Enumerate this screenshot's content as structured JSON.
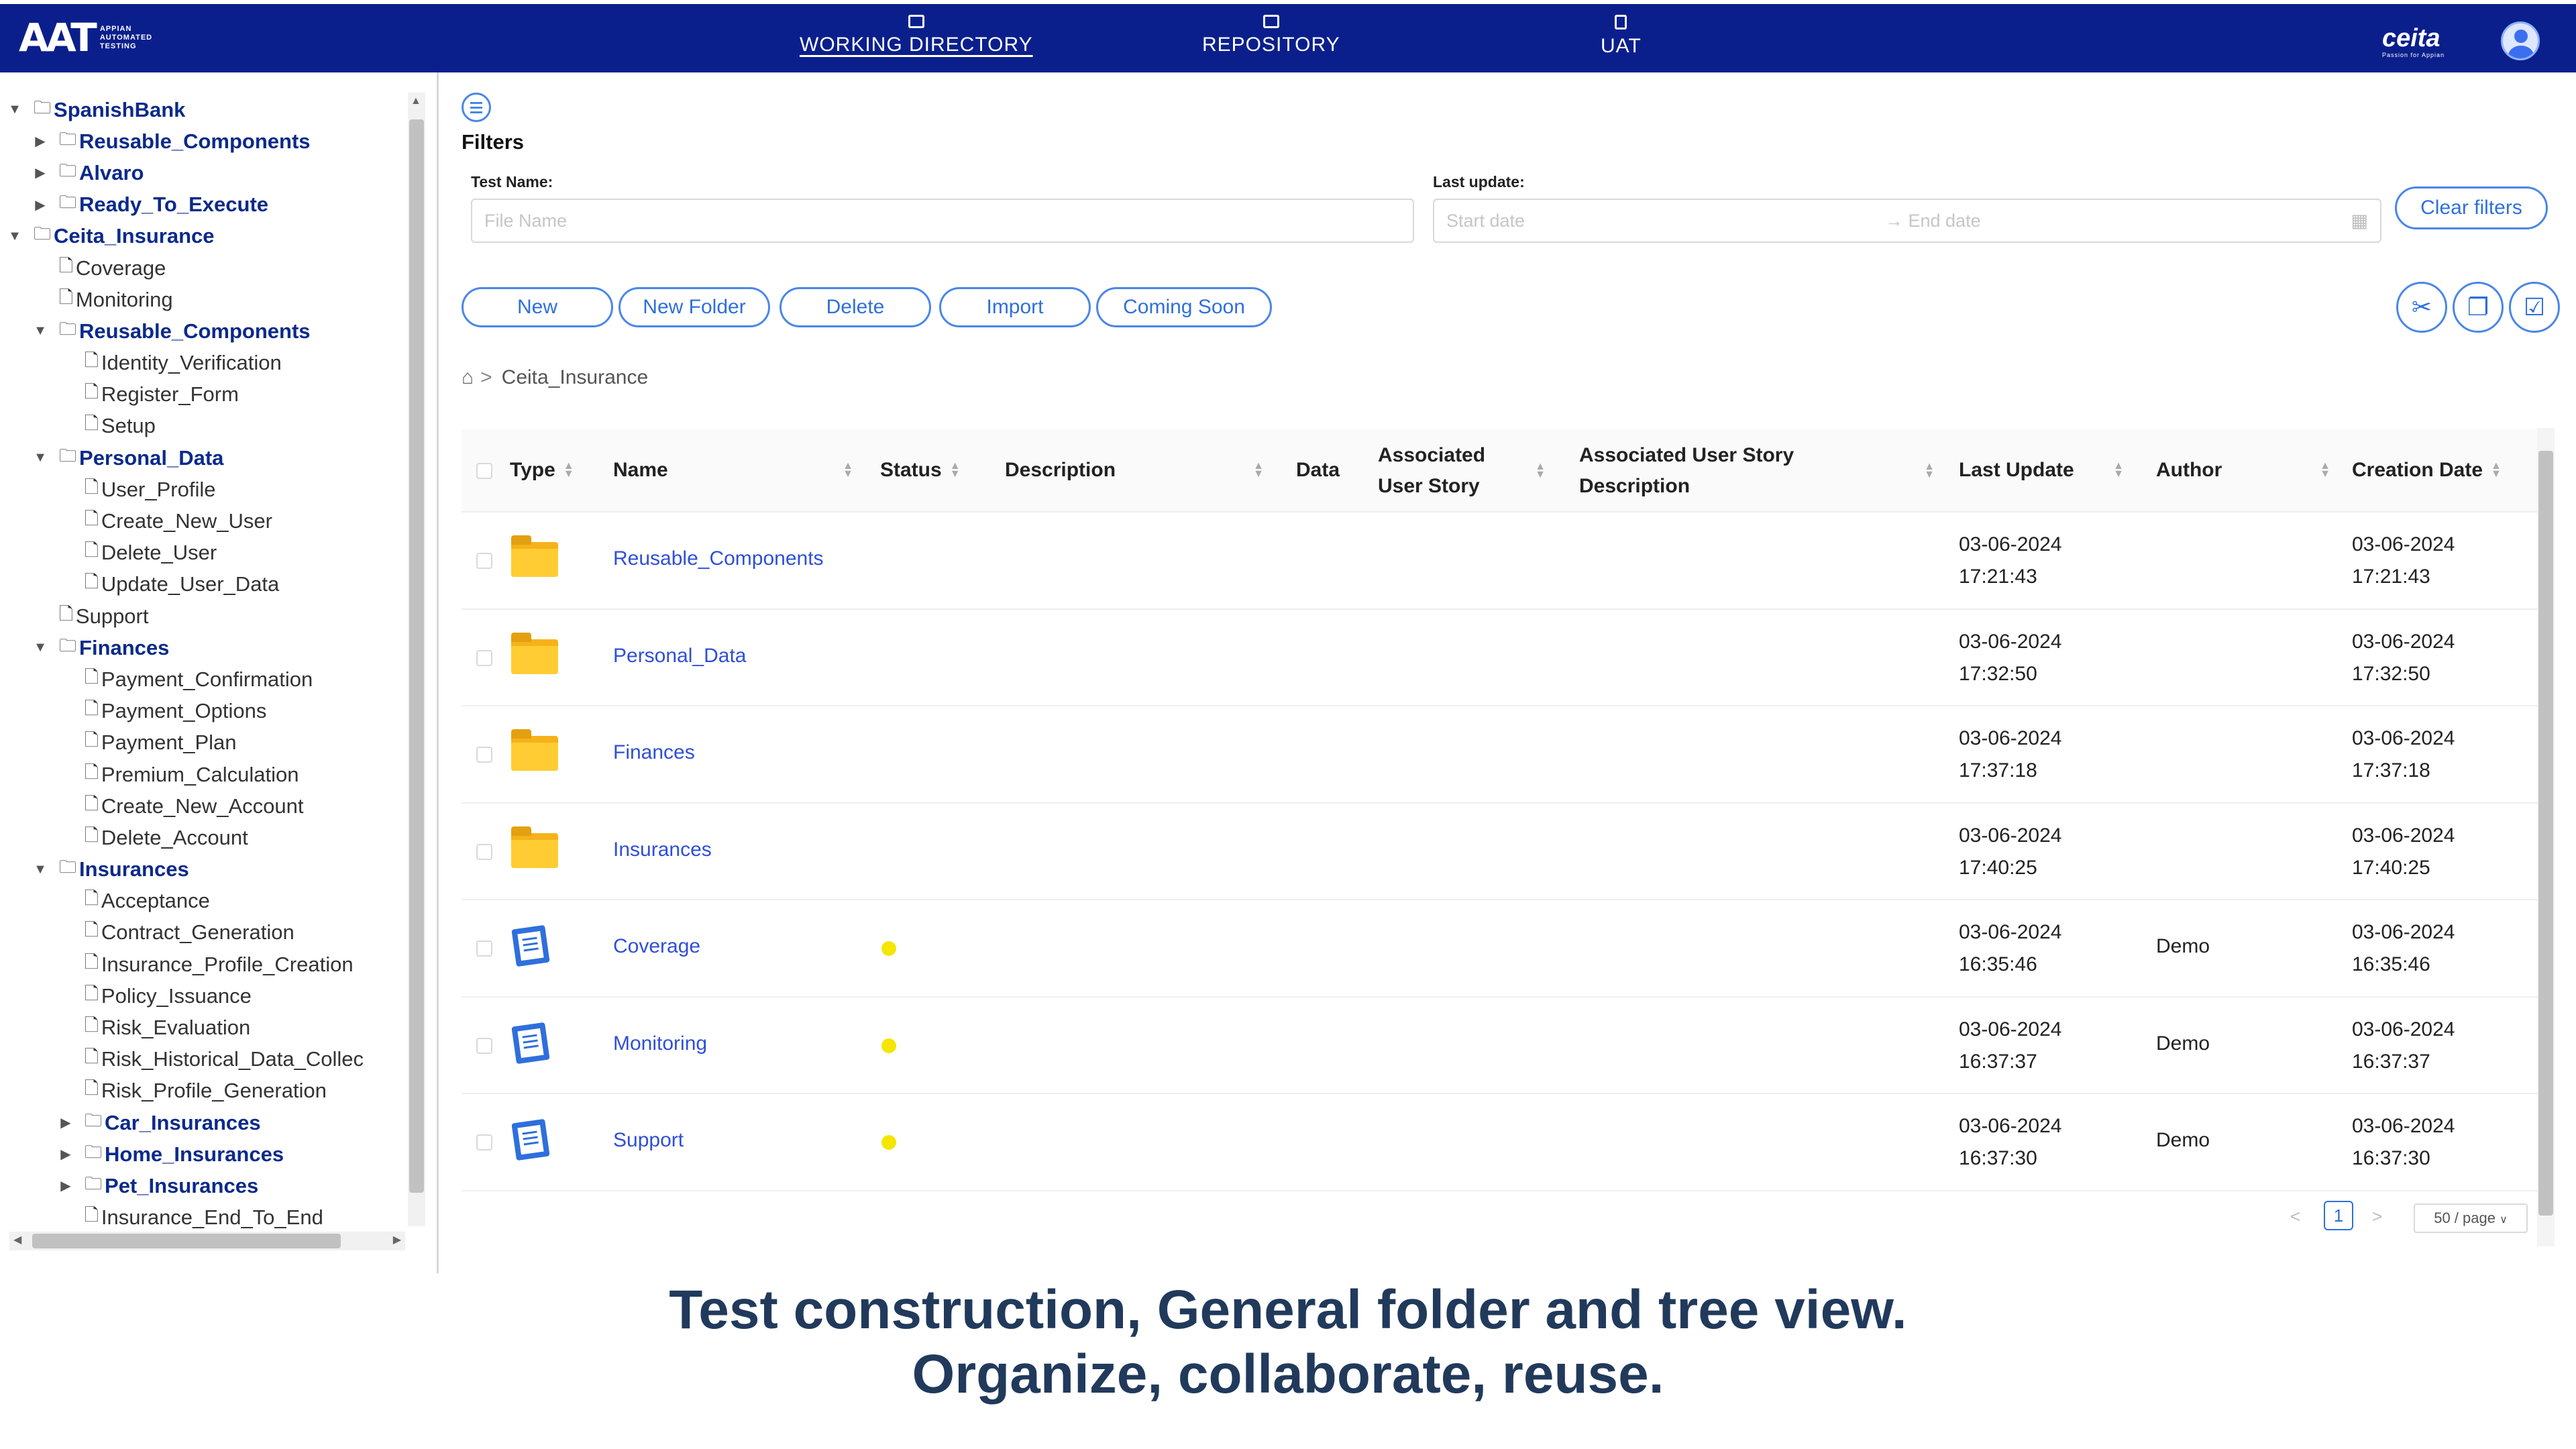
{
  "nav": {
    "logo": "AAT",
    "logo_sub": "APPIAN AUTOMATED TESTING",
    "items": [
      {
        "label": "WORKING DIRECTORY",
        "icon": "folder-grid-icon"
      },
      {
        "label": "REPOSITORY",
        "icon": "folder-icon"
      },
      {
        "label": "UAT",
        "icon": "clipboard-icon"
      }
    ],
    "brand": "ceita",
    "brand_sub": "Passion for Appian"
  },
  "tree": [
    {
      "label": "SpanishBank",
      "type": "folder",
      "toggle": "▼"
    },
    {
      "label": "Reusable_Components",
      "type": "folder",
      "toggle": "▶"
    },
    {
      "label": "Alvaro",
      "type": "folder",
      "toggle": "▶"
    },
    {
      "label": "Ready_To_Execute",
      "type": "folder",
      "toggle": "▶"
    },
    {
      "label": "Ceita_Insurance",
      "type": "folder",
      "toggle": "▼"
    },
    {
      "label": "Coverage",
      "type": "file"
    },
    {
      "label": "Monitoring",
      "type": "file"
    },
    {
      "label": "Reusable_Components",
      "type": "folder",
      "toggle": "▼"
    },
    {
      "label": "Identity_Verification",
      "type": "file"
    },
    {
      "label": "Register_Form",
      "type": "file"
    },
    {
      "label": "Setup",
      "type": "file"
    },
    {
      "label": "Personal_Data",
      "type": "folder",
      "toggle": "▼"
    },
    {
      "label": "User_Profile",
      "type": "file"
    },
    {
      "label": "Create_New_User",
      "type": "file"
    },
    {
      "label": "Delete_User",
      "type": "file"
    },
    {
      "label": "Update_User_Data",
      "type": "file"
    },
    {
      "label": "Support",
      "type": "file"
    },
    {
      "label": "Finances",
      "type": "folder",
      "toggle": "▼"
    },
    {
      "label": "Payment_Confirmation",
      "type": "file"
    },
    {
      "label": "Payment_Options",
      "type": "file"
    },
    {
      "label": "Payment_Plan",
      "type": "file"
    },
    {
      "label": "Premium_Calculation",
      "type": "file"
    },
    {
      "label": "Create_New_Account",
      "type": "file"
    },
    {
      "label": "Delete_Account",
      "type": "file"
    },
    {
      "label": "Insurances",
      "type": "folder",
      "toggle": "▼"
    },
    {
      "label": "Acceptance",
      "type": "file"
    },
    {
      "label": "Contract_Generation",
      "type": "file"
    },
    {
      "label": "Insurance_Profile_Creation",
      "type": "file"
    },
    {
      "label": "Policy_Issuance",
      "type": "file"
    },
    {
      "label": "Risk_Evaluation",
      "type": "file"
    },
    {
      "label": "Risk_Historical_Data_Collec",
      "type": "file"
    },
    {
      "label": "Risk_Profile_Generation",
      "type": "file"
    },
    {
      "label": "Car_Insurances",
      "type": "folder",
      "toggle": "▶"
    },
    {
      "label": "Home_Insurances",
      "type": "folder",
      "toggle": "▶"
    },
    {
      "label": "Pet_Insurances",
      "type": "folder",
      "toggle": "▶"
    },
    {
      "label": "Insurance_End_To_End",
      "type": "file"
    }
  ],
  "filters": {
    "title": "Filters",
    "test_name_label": "Test Name:",
    "test_name_placeholder": "File Name",
    "last_update_label": "Last update:",
    "start_placeholder": "Start date",
    "end_placeholder": "→ End date",
    "clear_label": "Clear filters"
  },
  "actions": [
    "New",
    "New Folder",
    "Delete",
    "Import",
    "Coming Soon"
  ],
  "tools": [
    {
      "icon": "scissors-icon",
      "glyph": "✂"
    },
    {
      "icon": "copy-icon",
      "glyph": "❐"
    },
    {
      "icon": "clipboard-check-icon",
      "glyph": "☑"
    }
  ],
  "breadcrumb": {
    "home_icon": "home-icon",
    "sep": ">",
    "current": "Ceita_Insurance"
  },
  "table": {
    "headers": {
      "type": "Type",
      "name": "Name",
      "status": "Status",
      "description": "Description",
      "data": "Data",
      "assoc_story_1": "Associated",
      "assoc_story_2": "User Story",
      "assoc_desc_1": "Associated User Story",
      "assoc_desc_2": "Description",
      "last_update": "Last Update",
      "author": "Author",
      "creation_date": "Creation Date"
    },
    "rows": [
      {
        "kind": "folder",
        "name": "Reusable_Components",
        "status": "",
        "last_date": "03-06-2024",
        "last_time": "17:21:43",
        "author": "",
        "created_date": "03-06-2024",
        "created_time": "17:21:43"
      },
      {
        "kind": "folder",
        "name": "Personal_Data",
        "status": "",
        "last_date": "03-06-2024",
        "last_time": "17:32:50",
        "author": "",
        "created_date": "03-06-2024",
        "created_time": "17:32:50"
      },
      {
        "kind": "folder",
        "name": "Finances",
        "status": "",
        "last_date": "03-06-2024",
        "last_time": "17:37:18",
        "author": "",
        "created_date": "03-06-2024",
        "created_time": "17:37:18"
      },
      {
        "kind": "folder",
        "name": "Insurances",
        "status": "",
        "last_date": "03-06-2024",
        "last_time": "17:40:25",
        "author": "",
        "created_date": "03-06-2024",
        "created_time": "17:40:25"
      },
      {
        "kind": "test",
        "name": "Coverage",
        "status": "yellow",
        "last_date": "03-06-2024",
        "last_time": "16:35:46",
        "author": "Demo",
        "created_date": "03-06-2024",
        "created_time": "16:35:46"
      },
      {
        "kind": "test",
        "name": "Monitoring",
        "status": "yellow",
        "last_date": "03-06-2024",
        "last_time": "16:37:37",
        "author": "Demo",
        "created_date": "03-06-2024",
        "created_time": "16:37:37"
      },
      {
        "kind": "test",
        "name": "Support",
        "status": "yellow",
        "last_date": "03-06-2024",
        "last_time": "16:37:30",
        "author": "Demo",
        "created_date": "03-06-2024",
        "created_time": "16:37:30"
      }
    ]
  },
  "pagination": {
    "prev": "<",
    "current": "1",
    "next": ">",
    "page_size": "50 / page"
  },
  "caption": {
    "line1": "Test construction, General folder and tree view.",
    "line2": "Organize, collaborate, reuse."
  },
  "colors": {
    "nav_bg": "#0b1f8c",
    "accent": "#2f6fdc",
    "status_yellow": "#f5e600",
    "folder": "#ffcc33"
  }
}
